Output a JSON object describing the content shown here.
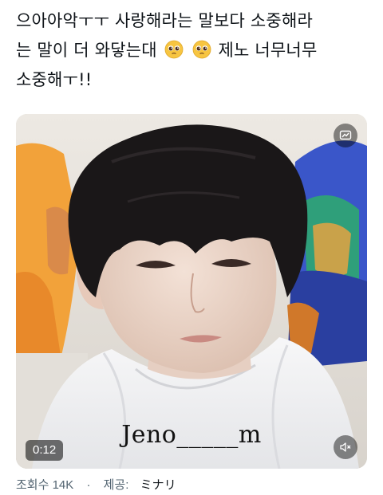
{
  "tweet": {
    "lines": [
      "으아아악ㅜㅜ 사랑해라는 말보다 소중해라",
      "는 말이 더 와닿는대",
      "제노 너무너무",
      "소중해ㅜ!!"
    ],
    "emoji": [
      "pleading-face",
      "pleading-face"
    ]
  },
  "media": {
    "caption": "Jeno_____m",
    "duration": "0:12",
    "gif_icon": "alt-text-icon",
    "mute_icon": "speaker-muted-icon"
  },
  "meta": {
    "views_label": "조회수",
    "views_count": "14K",
    "separator": "·",
    "source_label": "제공:",
    "source_name": "ミナリ"
  },
  "colors": {
    "text": "#0f1419",
    "meta": "#536471",
    "overlay": "rgba(0,0,0,0.55)"
  }
}
